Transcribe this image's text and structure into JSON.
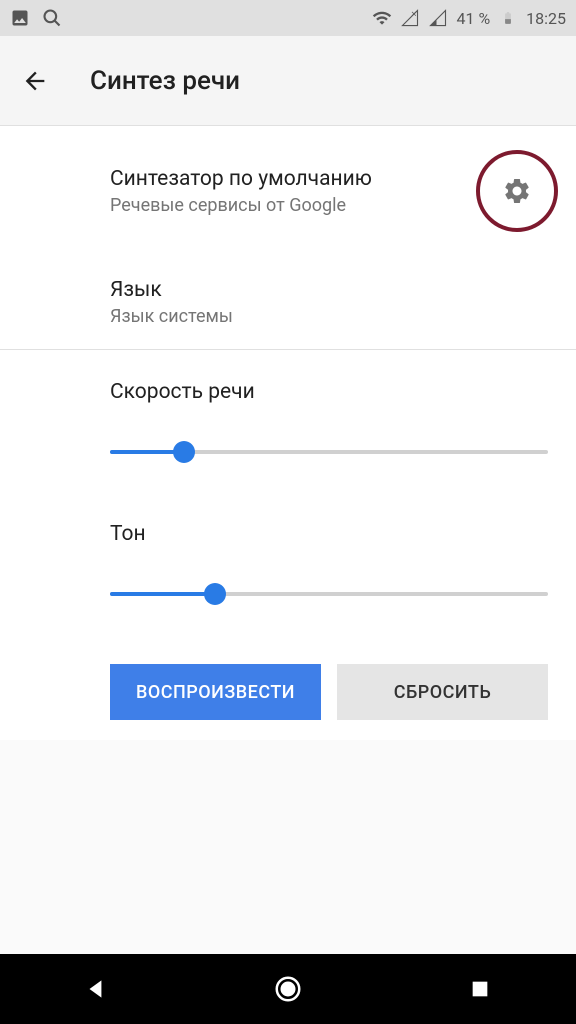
{
  "status_bar": {
    "battery_pct": "41 %",
    "time": "18:25"
  },
  "app_bar": {
    "title": "Синтез речи"
  },
  "settings": {
    "engine": {
      "title": "Синтезатор по умолчанию",
      "subtitle": "Речевые сервисы от Google"
    },
    "language": {
      "title": "Язык",
      "subtitle": "Язык системы"
    },
    "speech_rate": {
      "title": "Скорость речи",
      "value_pct": 17
    },
    "pitch": {
      "title": "Тон",
      "value_pct": 24
    }
  },
  "buttons": {
    "play": "ВОСПРОИЗВЕСТИ",
    "reset": "СБРОСИТЬ"
  },
  "colors": {
    "accent": "#297be5",
    "highlight_ring": "#7d1a2e"
  }
}
